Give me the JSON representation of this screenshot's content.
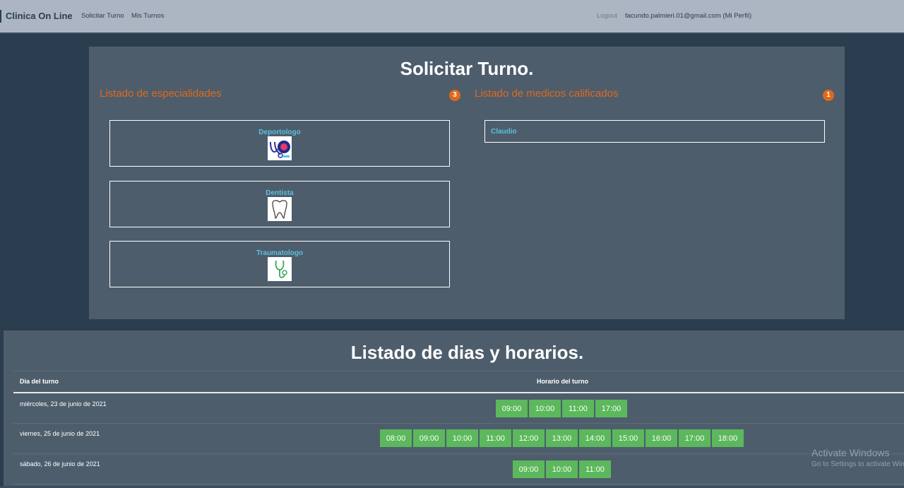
{
  "navbar": {
    "brand": "Clinica On Line",
    "links": [
      "Solicitar Turno",
      "Mis Turnos"
    ],
    "logout": "Logout",
    "user": "facundo.palmieri.01@gmail.com (Mi Perfil)"
  },
  "solicitar": {
    "title": "Solicitar Turno.",
    "especialidades": {
      "heading": "Listado de especialidades",
      "count": "3",
      "items": [
        {
          "name": "Deportologo",
          "icon": "sports-medicine-icon"
        },
        {
          "name": "Dentista",
          "icon": "tooth-icon"
        },
        {
          "name": "Traumatologo",
          "icon": "stethoscope-icon"
        }
      ]
    },
    "medicos": {
      "heading": "Listado de medicos calificados",
      "count": "1",
      "items": [
        "Claudio"
      ]
    }
  },
  "horarios": {
    "title": "Listado de dias y horarios.",
    "headers": {
      "day": "Dia del turno",
      "time": "Horario del turno"
    },
    "rows": [
      {
        "day": "miércoles, 23 de junio de 2021",
        "slots": [
          "09:00",
          "10:00",
          "11:00",
          "17:00"
        ]
      },
      {
        "day": "viernes, 25 de junio de 2021",
        "slots": [
          "08:00",
          "09:00",
          "10:00",
          "11:00",
          "12:00",
          "13:00",
          "14:00",
          "15:00",
          "16:00",
          "17:00",
          "18:00"
        ]
      },
      {
        "day": "sábado, 26 de junio de 2021",
        "slots": [
          "09:00",
          "10:00",
          "11:00"
        ]
      }
    ]
  },
  "windows": {
    "activate": "Activate Windows",
    "settings": "Go to Settings to activate Windows."
  },
  "colors": {
    "background": "#2b3e50",
    "panel": "#4e5d6c",
    "navbar": "#abb6c2",
    "accent": "#df691a",
    "link": "#5bc0de",
    "slot": "#5cb85c"
  }
}
